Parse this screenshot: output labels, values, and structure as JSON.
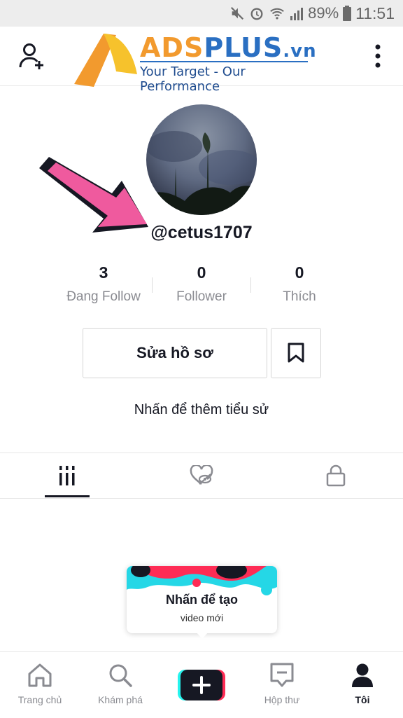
{
  "status_bar": {
    "battery": "89%",
    "time": "11:51"
  },
  "logo": {
    "brand": "ADSPLUS.vn",
    "tagline": "Your Target - Our Performance"
  },
  "profile": {
    "username": "@cetus1707",
    "bio_prompt": "Nhấn để thêm tiểu sử"
  },
  "stats": [
    {
      "value": "3",
      "label": "Đang Follow"
    },
    {
      "value": "0",
      "label": "Follower"
    },
    {
      "value": "0",
      "label": "Thích"
    }
  ],
  "actions": {
    "edit_profile": "Sửa hồ sơ"
  },
  "tooltip": {
    "title": "Nhấn để tạo",
    "subtitle": "video mới"
  },
  "bottom_nav": [
    {
      "label": "Trang chủ",
      "icon": "home-icon"
    },
    {
      "label": "Khám phá",
      "icon": "search-icon"
    },
    {
      "label": "",
      "icon": "plus-icon"
    },
    {
      "label": "Hộp thư",
      "icon": "inbox-icon"
    },
    {
      "label": "Tôi",
      "icon": "profile-icon",
      "active": true
    }
  ],
  "colors": {
    "accent_pink": "#ef5a9e",
    "tiktok_red": "#fe2c55",
    "tiktok_cyan": "#25f4ee",
    "logo_orange": "#f29a2e",
    "logo_blue": "#2a6fc2"
  }
}
